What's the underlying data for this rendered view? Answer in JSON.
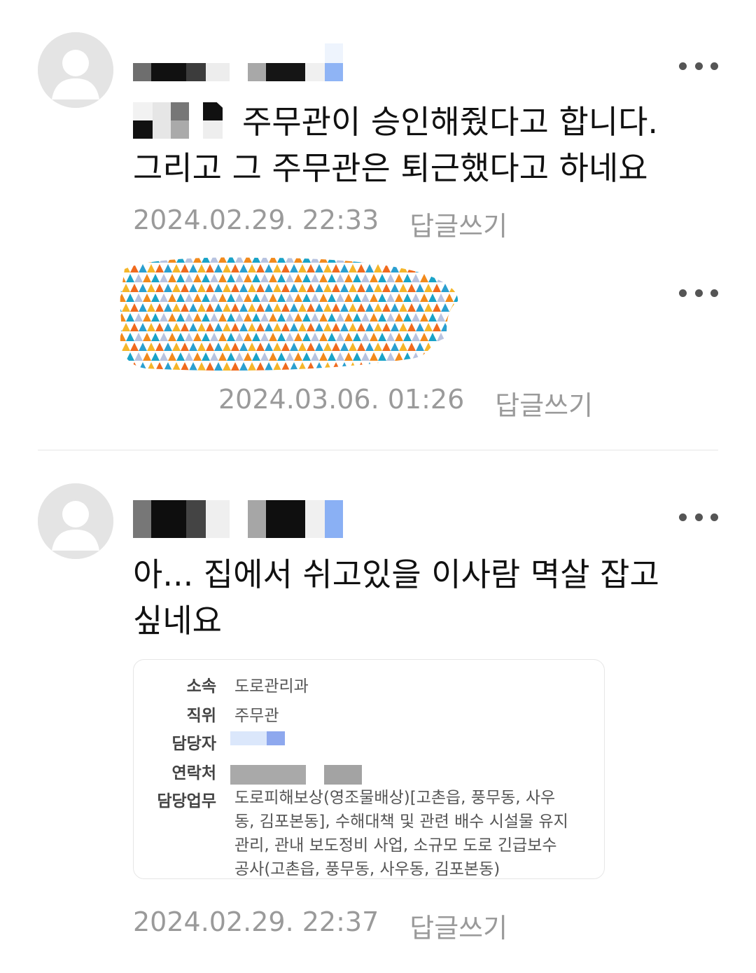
{
  "comments": [
    {
      "text_line1": "주무관이 승인해줬다고 합니다.",
      "text_line2": "그리고 그 주무관은 퇴근했다고 하네요",
      "timestamp": "2024.02.29. 22:33",
      "reply_label": "답글쓰기"
    },
    {
      "timestamp": "2024.03.06. 01:26",
      "reply_label": "답글쓰기"
    },
    {
      "text_line1": "아... 집에서 쉬고있을 이사람 멱살 잡고",
      "text_line2": "싶네요",
      "timestamp": "2024.02.29. 22:37",
      "reply_label": "답글쓰기",
      "card": {
        "rows": [
          {
            "label": "소속",
            "value": "도로관리과"
          },
          {
            "label": "직위",
            "value": "주무관"
          },
          {
            "label": "담당자",
            "value": ""
          },
          {
            "label": "연락처",
            "value": ""
          }
        ],
        "duty_label": "담당업무",
        "duty_lines": [
          "도로피해보상(영조물배상)[고촌읍, 풍무동, 사우",
          "동, 김포본동], 수해대책 및 관련 배수 시설물 유지",
          "관리, 관내 보도정비 사업, 소규모 도로 긴급보수",
          "공사(고촌읍, 풍무동, 사우동, 김포본동)"
        ]
      }
    }
  ],
  "icons": {
    "avatar": "default-profile-icon",
    "more": "more-horizontal-icon"
  }
}
